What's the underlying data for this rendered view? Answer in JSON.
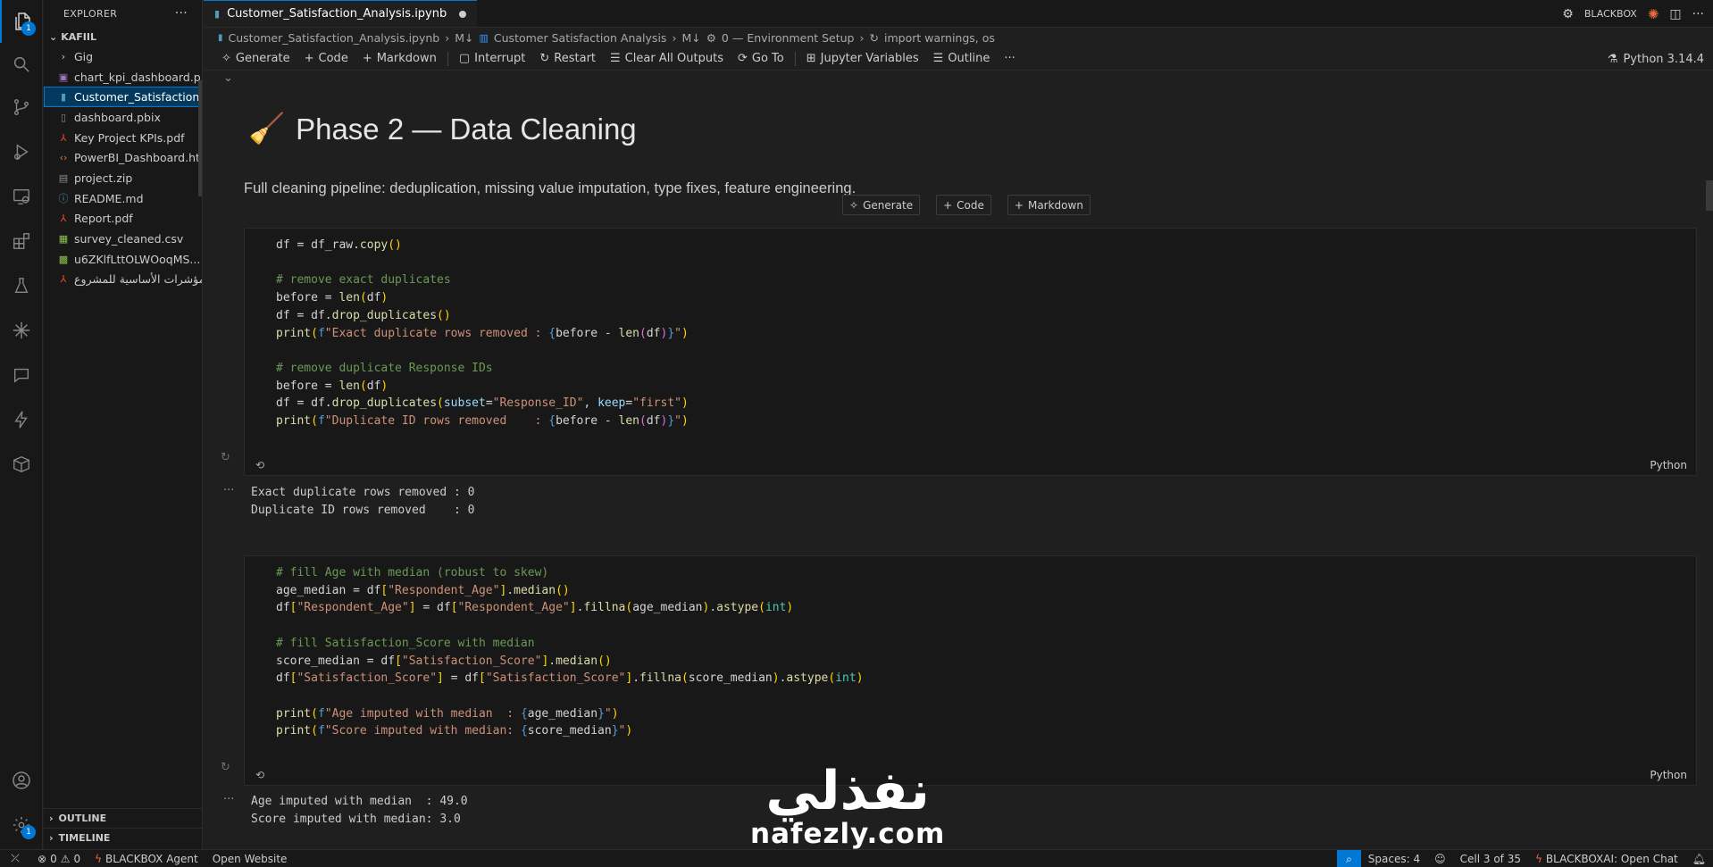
{
  "sidebar": {
    "title": "EXPLORER",
    "section": "KAFIIL",
    "items": [
      {
        "label": "Gig",
        "icon": "chevron-right-icon",
        "color": "#cccccc"
      },
      {
        "label": "chart_kpi_dashboard.p...",
        "icon": "image-file-icon",
        "color": "#a074c4"
      },
      {
        "label": "Customer_Satisfaction...",
        "icon": "notebook-file-icon",
        "color": "#519aba"
      },
      {
        "label": "dashboard.pbix",
        "icon": "file-icon",
        "color": "#8a8a8a"
      },
      {
        "label": "Key Project KPIs.pdf",
        "icon": "pdf-file-icon",
        "color": "#e44d26"
      },
      {
        "label": "PowerBI_Dashboard.ht...",
        "icon": "html-file-icon",
        "color": "#e37933"
      },
      {
        "label": "project.zip",
        "icon": "zip-file-icon",
        "color": "#8a8a8a"
      },
      {
        "label": "README.md",
        "icon": "info-file-icon",
        "color": "#519aba"
      },
      {
        "label": "Report.pdf",
        "icon": "pdf-file-icon",
        "color": "#e44d26"
      },
      {
        "label": "survey_cleaned.csv",
        "icon": "csv-file-icon",
        "color": "#8dc149"
      },
      {
        "label": "u6ZKlfLttOLWOoqMS...",
        "icon": "excel-file-icon",
        "color": "#8dc149"
      },
      {
        "label": "المؤشرات الأساسية للمشروع",
        "icon": "pdf-file-icon",
        "color": "#e44d26"
      }
    ],
    "outline": "OUTLINE",
    "timeline": "TIMELINE"
  },
  "activity_badge": "1",
  "accounts_badge": "1",
  "tab": {
    "label": "Customer_Satisfaction_Analysis.ipynb"
  },
  "topright": {
    "brand": "BLACKBOX"
  },
  "breadcrumb": {
    "file": "Customer_Satisfaction_Analysis.ipynb",
    "sep1": "M↓",
    "section": "Customer Satisfaction Analysis",
    "sep2": "M↓",
    "sub": "0 — Environment Setup",
    "code": "import warnings, os"
  },
  "toolbar": {
    "generate": "Generate",
    "code": "Code",
    "markdown": "Markdown",
    "interrupt": "Interrupt",
    "restart": "Restart",
    "clear": "Clear All Outputs",
    "goto": "Go To",
    "variables": "Jupyter Variables",
    "outline": "Outline",
    "more": "···",
    "kernel": "Python 3.14.4"
  },
  "markdown": {
    "emoji": "🧹",
    "title": "Phase 2 — Data Cleaning",
    "para": "Full cleaning pipeline: deduplication, missing value imputation, type fixes, feature engineering."
  },
  "insert": {
    "generate": "Generate",
    "code": "Code",
    "markdown": "Markdown"
  },
  "cell1": {
    "lang": "Python",
    "output": [
      "Exact duplicate rows removed : 0",
      "Duplicate ID rows removed    : 0"
    ]
  },
  "cell2": {
    "lang": "Python",
    "output": [
      "Age imputed with median  : 49.0",
      "Score imputed with median: 3.0"
    ]
  },
  "watermark": {
    "arabic": "نفذلي",
    "latin": "nafezly.com"
  },
  "status": {
    "problems": "0",
    "warnings": "0",
    "agent": "BLACKBOX Agent",
    "website": "Open Website",
    "spaces": "Spaces: 4",
    "cell": "Cell 3 of 35",
    "chat": "BLACKBOXAI: Open Chat"
  },
  "colors": {
    "accent": "#0078d4",
    "background": "#1f1f1f",
    "sidebar": "#181818"
  }
}
